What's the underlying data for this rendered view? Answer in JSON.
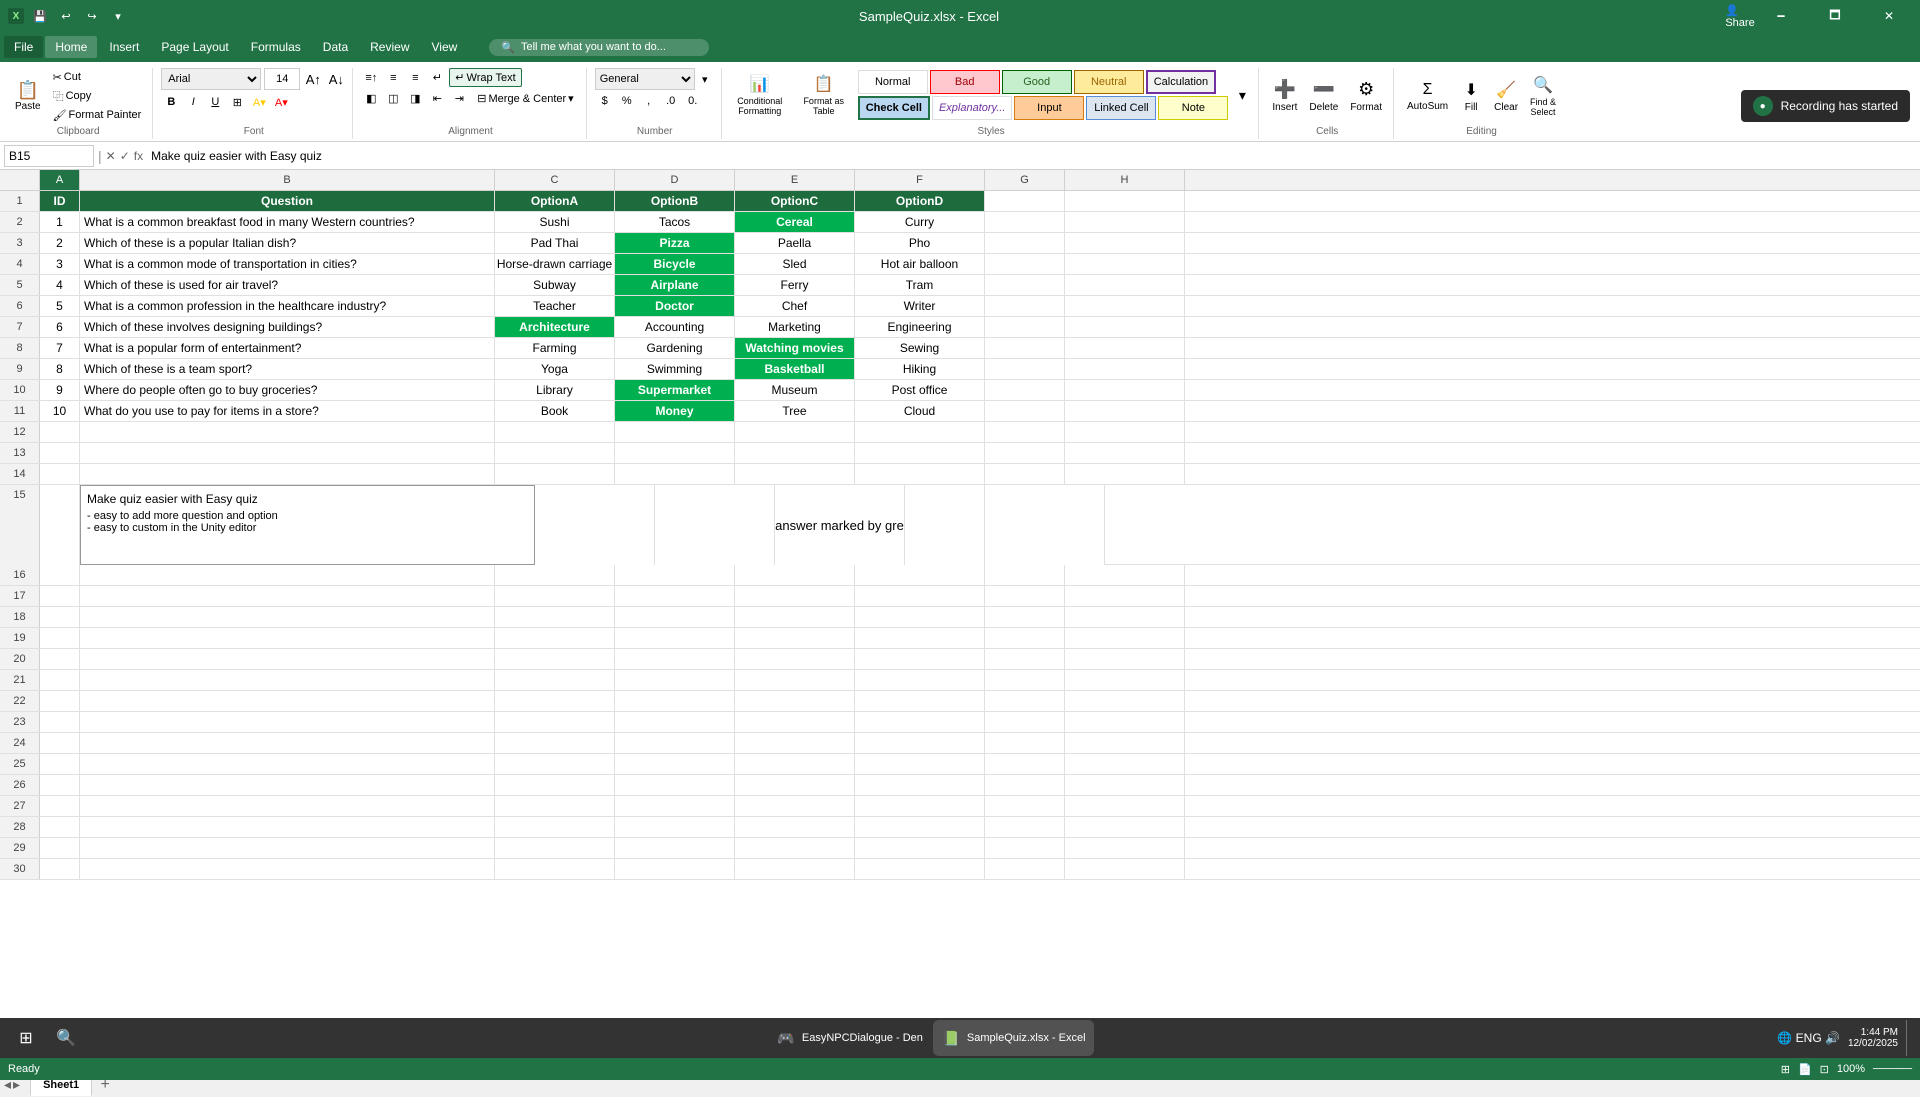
{
  "title_bar": {
    "title": "SampleQuiz.xlsx - Excel",
    "save_icon": "💾",
    "undo_icon": "↩",
    "redo_icon": "↪",
    "minimize": "🗕",
    "maximize": "🗖",
    "close": "✕"
  },
  "menu": {
    "items": [
      "File",
      "Home",
      "Insert",
      "Page Layout",
      "Formulas",
      "Data",
      "Review",
      "View"
    ],
    "active": "Home",
    "search_placeholder": "Tell me what you want to do...",
    "share": "Share"
  },
  "ribbon": {
    "clipboard": {
      "label": "Clipboard",
      "paste": "Paste",
      "cut": "Cut",
      "copy": "Copy",
      "format_painter": "Format Painter"
    },
    "font": {
      "label": "Font",
      "family": "Arial",
      "size": "14",
      "bold": "B",
      "italic": "I",
      "underline": "U",
      "border": "⊞",
      "fill": "A",
      "color": "A"
    },
    "alignment": {
      "label": "Alignment",
      "wrap_text": "Wrap Text",
      "merge_center": "Merge & Center"
    },
    "number": {
      "label": "Number",
      "format": "General"
    },
    "styles": {
      "label": "Styles",
      "conditional": "Conditional\nFormatting",
      "format_as_table": "Format as\nTable",
      "normal": "Normal",
      "bad": "Bad",
      "good": "Good",
      "neutral": "Neutral",
      "calculation": "Calculation",
      "check_cell": "Check Cell",
      "explanatory": "Explanatory...",
      "input": "Input",
      "linked_cell": "Linked Cell",
      "note": "Note"
    },
    "cells": {
      "label": "Cells",
      "insert": "Insert",
      "delete": "Delete",
      "format": "Format"
    },
    "editing": {
      "label": "Editing",
      "autosum": "AutoSum",
      "fill": "Fill",
      "clear": "Clear"
    }
  },
  "formula_bar": {
    "name_box": "B15",
    "formula": "Make quiz easier with Easy quiz"
  },
  "columns": [
    "A",
    "B",
    "C",
    "D",
    "E",
    "F",
    "G",
    "H"
  ],
  "headers": {
    "row": 1,
    "cells": [
      "ID",
      "Question",
      "OptionA",
      "OptionB",
      "OptionC",
      "OptionD",
      "",
      ""
    ]
  },
  "data_rows": [
    {
      "id": 1,
      "q": "What is a common breakfast food in many Western countries?",
      "a": "Sushi",
      "b": "Tacos",
      "c": "Cereal",
      "d": "Curry",
      "c_green": true,
      "b_green": false,
      "d_green": false,
      "a_green": false
    },
    {
      "id": 2,
      "q": "Which of these is a popular Italian dish?",
      "a": "Pad Thai",
      "b": "Pizza",
      "c": "Paella",
      "d": "Pho",
      "b_green": true
    },
    {
      "id": 3,
      "q": "What is a common mode of transportation in cities?",
      "a": "Horse-drawn carriage",
      "b": "Bicycle",
      "c": "Sled",
      "d": "Hot air balloon",
      "b_green": true
    },
    {
      "id": 4,
      "q": "Which of these is used for air travel?",
      "a": "Subway",
      "b": "Airplane",
      "c": "Ferry",
      "d": "Tram",
      "b_green": true
    },
    {
      "id": 5,
      "q": "What is a common profession in the healthcare industry?",
      "a": "Teacher",
      "b": "Doctor",
      "c": "Chef",
      "d": "Writer",
      "b_green": true
    },
    {
      "id": 6,
      "q": "Which of these involves designing buildings?",
      "a": "Architecture",
      "b": "Accounting",
      "c": "Marketing",
      "d": "Engineering",
      "a_green": true,
      "a_yellow": true
    },
    {
      "id": 7,
      "q": "What is a popular form of entertainment?",
      "a": "Farming",
      "b": "Gardening",
      "c": "Watching movies",
      "d": "Sewing",
      "c_green": true
    },
    {
      "id": 8,
      "q": "Which of these is a team sport?",
      "a": "Yoga",
      "b": "Swimming",
      "c": "Basketball",
      "d": "Hiking",
      "c_green": true
    },
    {
      "id": 9,
      "q": "Where do people often go to buy groceries?",
      "a": "Library",
      "b": "Supermarket",
      "c": "Museum",
      "d": "Post office",
      "b_green": true
    },
    {
      "id": 10,
      "q": "What do you use to pay for items in a store?",
      "a": "Book",
      "b": "Money",
      "c": "Tree",
      "d": "Cloud",
      "b_green": true
    }
  ],
  "note": {
    "line1": "Make quiz easier with Easy quiz",
    "line2": "- easy to add more question and option",
    "line3": "- easy to custom in the Unity editor"
  },
  "aside_text": "Correct answer marked by green color",
  "recording": {
    "text": "Recording has started"
  },
  "sheet_tabs": [
    "Sheet1"
  ],
  "status": {
    "ready": "Ready"
  },
  "taskbar": {
    "time": "1:44 PM",
    "date": "12/02/2025",
    "apps": [
      {
        "name": "EasyNPCDialogue - Den",
        "icon": "🎮"
      },
      {
        "name": "SampleQuiz.xlsx - Excel",
        "icon": "📗"
      }
    ]
  }
}
